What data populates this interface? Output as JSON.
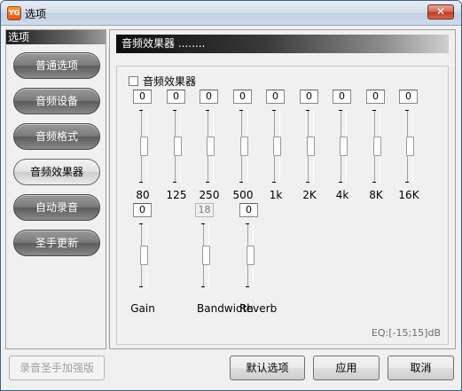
{
  "window": {
    "title": "选项",
    "app_icon_text": "YG",
    "close_glyph": "✕"
  },
  "sidebar": {
    "header": "选项",
    "items": [
      {
        "label": "普通选项",
        "active": false
      },
      {
        "label": "音频设备",
        "active": false
      },
      {
        "label": "音频格式",
        "active": false
      },
      {
        "label": "音频效果器",
        "active": true
      },
      {
        "label": "自动录音",
        "active": false
      },
      {
        "label": "圣手更新",
        "active": false
      }
    ]
  },
  "main": {
    "section_header": "音频效果器 ........",
    "group_checkbox_label": "音频效果器",
    "equalizer": [
      {
        "label": "80",
        "value": "0"
      },
      {
        "label": "125",
        "value": "0"
      },
      {
        "label": "250",
        "value": "0"
      },
      {
        "label": "500",
        "value": "0"
      },
      {
        "label": "1k",
        "value": "0"
      },
      {
        "label": "2K",
        "value": "0"
      },
      {
        "label": "4k",
        "value": "0"
      },
      {
        "label": "8K",
        "value": "0"
      },
      {
        "label": "16K",
        "value": "0"
      }
    ],
    "effects": [
      {
        "label": "Gain",
        "value": "0",
        "enabled": true
      },
      {
        "label": "Bandwidth",
        "value": "18",
        "enabled": false
      },
      {
        "label": "Reverb",
        "value": "0",
        "enabled": true
      }
    ],
    "eq_range": "EQ:[-15;15]dB"
  },
  "footer": {
    "left_button": "录音圣手加强版",
    "default_button": "默认选项",
    "apply_button": "应用",
    "cancel_button": "取消"
  }
}
